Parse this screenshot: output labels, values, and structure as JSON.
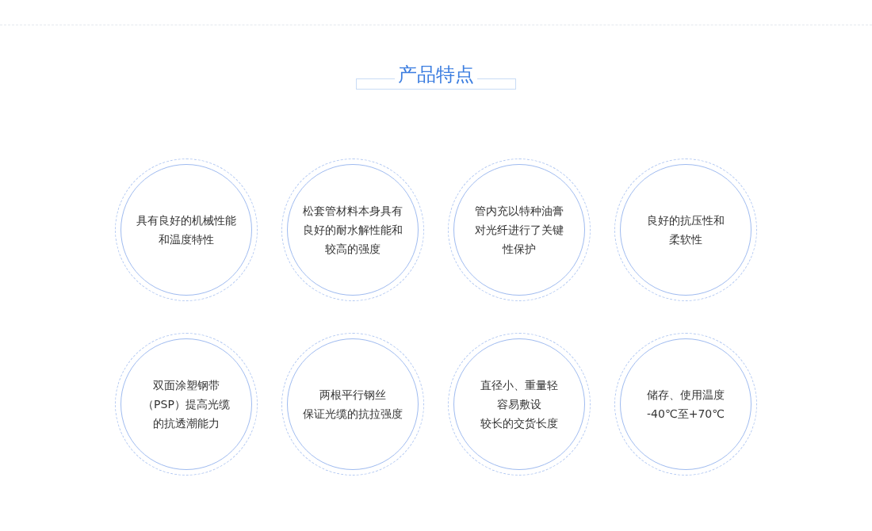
{
  "section_title": "产品特点",
  "features": [
    {
      "lines": [
        "具有良好的机械性能",
        "和温度特性"
      ]
    },
    {
      "lines": [
        "松套管材料本身具有",
        "良好的耐水解性能和",
        "较高的强度"
      ]
    },
    {
      "lines": [
        "管内充以特种油膏",
        "对光纤进行了关键",
        "性保护"
      ]
    },
    {
      "lines": [
        "良好的抗压性和",
        "柔软性"
      ]
    },
    {
      "lines": [
        "双面涂塑钢带",
        "（PSP）提高光缆",
        "的抗透潮能力"
      ]
    },
    {
      "lines": [
        "两根平行钢丝",
        "保证光缆的抗拉强度"
      ]
    },
    {
      "lines": [
        "直径小、重量轻",
        "容易敷设",
        "较长的交货长度"
      ]
    },
    {
      "lines": [
        "储存、使用温度",
        "-40℃至+70℃"
      ]
    }
  ]
}
